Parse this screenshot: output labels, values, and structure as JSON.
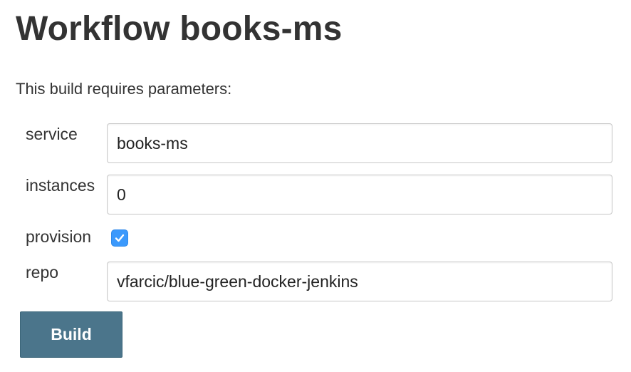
{
  "page": {
    "title": "Workflow books-ms",
    "intro": "This build requires parameters:"
  },
  "parameters": [
    {
      "label": "service",
      "type": "text",
      "value": "books-ms"
    },
    {
      "label": "instances",
      "type": "text",
      "value": "0"
    },
    {
      "label": "provision",
      "type": "checkbox",
      "checked": true
    },
    {
      "label": "repo",
      "type": "text",
      "value": "vfarcic/blue-green-docker-jenkins"
    }
  ],
  "actions": {
    "build_label": "Build"
  },
  "colors": {
    "build_button_bg": "#4b758b",
    "checkbox_accent": "#3b99fc",
    "text": "#333333"
  }
}
